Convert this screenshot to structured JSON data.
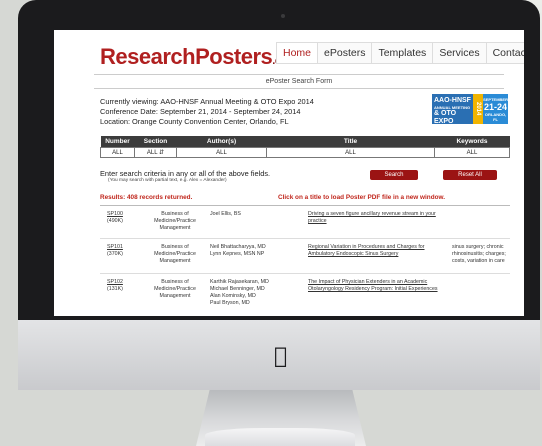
{
  "site": {
    "logo_part1": "Research",
    "logo_part2": "Posters",
    "logo_part3": ".com",
    "nav": [
      "Home",
      "ePosters",
      "Templates",
      "Services",
      "Contact"
    ]
  },
  "form_title": "ePoster Search Form",
  "meeting": {
    "viewing": "Currently viewing: AAO-HNSF Annual Meeting & OTO Expo 2014",
    "dates": "Conference Date: September 21, 2014 - September 24, 2014",
    "location": "Location: Orange County Convention Center, Orlando, FL"
  },
  "badge": {
    "line1": "AAO-HNSF",
    "line2": "ANNUAL MEETING",
    "line3": "& OTO EXPO",
    "year": "2014",
    "month": "SEPTEMBER",
    "days": "21-24",
    "city": "ORLANDO, FL"
  },
  "search": {
    "headers": [
      "Number",
      "Section",
      "Author(s)",
      "Title",
      "Keywords"
    ],
    "values": [
      "ALL",
      "ALL",
      "ALL",
      "ALL",
      "ALL"
    ],
    "instruction": "Enter search criteria in any or all of the above fields.",
    "hint": "(You may search with partial text, e.g. Alex = Alexander)",
    "search_label": "Search",
    "reset_label": "Reset All"
  },
  "results_text": "Results: 408 records returned.",
  "click_note": "Click on a title to load Poster PDF file in a new window.",
  "records": [
    {
      "number": "SP100",
      "size": "(490K)",
      "section": "Business of Medicine/Practice Management",
      "authors": "Joel Ellis, BS",
      "title": "Driving a seven figure ancillary revenue stream in your practice",
      "keywords": ""
    },
    {
      "number": "SP101",
      "size": "(370K)",
      "section": "Business of Medicine/Practice Management",
      "authors": "Neil Bhattacharyya, MD\nLynn Kepnes, MSN NP",
      "title": "Regional Variation in Procedures and Charges for Ambulatory Endoscopic Sinus Surgery",
      "keywords": "sinus surgery; chronic rhinosinusitis; charges; costs, variation in care"
    },
    {
      "number": "SP102",
      "size": "(131K)",
      "section": "Business of Medicine/Practice Management",
      "authors": "Karthik Rajasekaran, MD\nMichael Benninger, MD\nAlan Kominsky, MD\nPaul Bryson, MD",
      "title": "The Impact of Physician Extenders in an Academic Otolaryngology Residency Program: Initial Experiences",
      "keywords": ""
    }
  ],
  "colors": {
    "brand_red": "#b02020",
    "button_red": "#9b1313",
    "header_dark": "#3c3c3c",
    "badge_blue": "#2a6fb3"
  }
}
